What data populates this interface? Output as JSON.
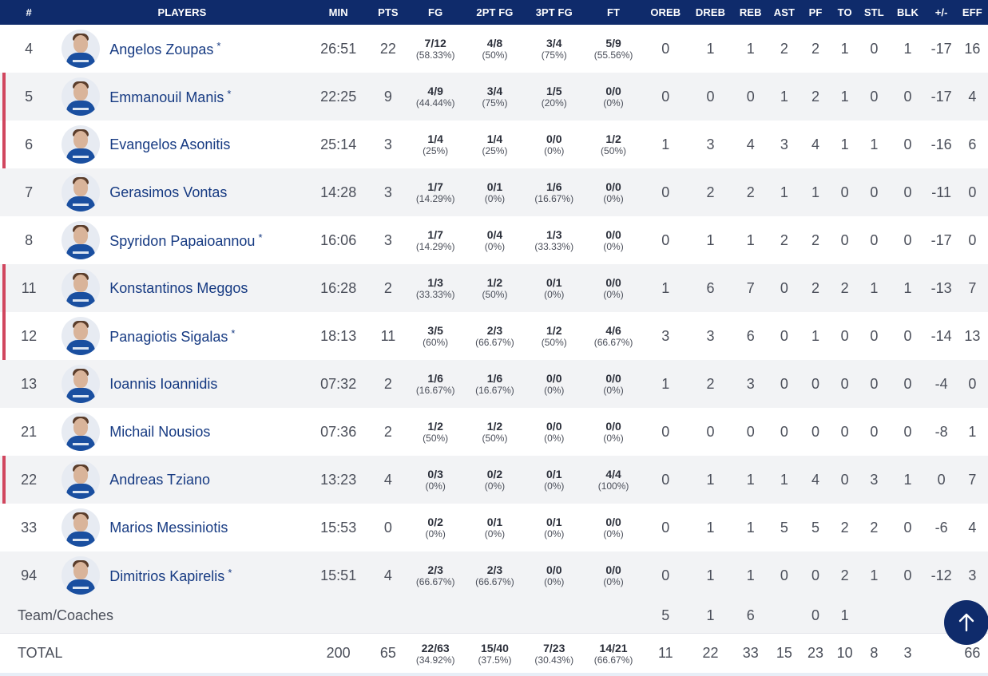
{
  "columns": [
    "#",
    "PLAYERS",
    "MIN",
    "PTS",
    "FG",
    "2PT FG",
    "3PT FG",
    "FT",
    "OREB",
    "DREB",
    "REB",
    "AST",
    "PF",
    "TO",
    "STL",
    "BLK",
    "+/-",
    "EFF"
  ],
  "players": [
    {
      "num": "4",
      "name": "Angelos Zoupas",
      "star": "*",
      "min": "26:51",
      "pts": "22",
      "fg": "7/12",
      "fg_pct": "(58.33%)",
      "two": "4/8",
      "two_pct": "(50%)",
      "three": "3/4",
      "three_pct": "(75%)",
      "ft": "5/9",
      "ft_pct": "(55.56%)",
      "oreb": "0",
      "dreb": "1",
      "reb": "1",
      "ast": "2",
      "pf": "2",
      "to": "1",
      "stl": "0",
      "blk": "1",
      "pm": "-17",
      "eff": "16"
    },
    {
      "num": "5",
      "name": "Emmanouil Manis",
      "star": "*",
      "min": "22:25",
      "pts": "9",
      "fg": "4/9",
      "fg_pct": "(44.44%)",
      "two": "3/4",
      "two_pct": "(75%)",
      "three": "1/5",
      "three_pct": "(20%)",
      "ft": "0/0",
      "ft_pct": "(0%)",
      "oreb": "0",
      "dreb": "0",
      "reb": "0",
      "ast": "1",
      "pf": "2",
      "to": "1",
      "stl": "0",
      "blk": "0",
      "pm": "-17",
      "eff": "4"
    },
    {
      "num": "6",
      "name": "Evangelos Asonitis",
      "star": "",
      "min": "25:14",
      "pts": "3",
      "fg": "1/4",
      "fg_pct": "(25%)",
      "two": "1/4",
      "two_pct": "(25%)",
      "three": "0/0",
      "three_pct": "(0%)",
      "ft": "1/2",
      "ft_pct": "(50%)",
      "oreb": "1",
      "dreb": "3",
      "reb": "4",
      "ast": "3",
      "pf": "4",
      "to": "1",
      "stl": "1",
      "blk": "0",
      "pm": "-16",
      "eff": "6"
    },
    {
      "num": "7",
      "name": "Gerasimos Vontas",
      "star": "",
      "min": "14:28",
      "pts": "3",
      "fg": "1/7",
      "fg_pct": "(14.29%)",
      "two": "0/1",
      "two_pct": "(0%)",
      "three": "1/6",
      "three_pct": "(16.67%)",
      "ft": "0/0",
      "ft_pct": "(0%)",
      "oreb": "0",
      "dreb": "2",
      "reb": "2",
      "ast": "1",
      "pf": "1",
      "to": "0",
      "stl": "0",
      "blk": "0",
      "pm": "-11",
      "eff": "0"
    },
    {
      "num": "8",
      "name": "Spyridon Papaioannou",
      "star": "*",
      "min": "16:06",
      "pts": "3",
      "fg": "1/7",
      "fg_pct": "(14.29%)",
      "two": "0/4",
      "two_pct": "(0%)",
      "three": "1/3",
      "three_pct": "(33.33%)",
      "ft": "0/0",
      "ft_pct": "(0%)",
      "oreb": "0",
      "dreb": "1",
      "reb": "1",
      "ast": "2",
      "pf": "2",
      "to": "0",
      "stl": "0",
      "blk": "0",
      "pm": "-17",
      "eff": "0"
    },
    {
      "num": "11",
      "name": "Konstantinos Meggos",
      "star": "",
      "min": "16:28",
      "pts": "2",
      "fg": "1/3",
      "fg_pct": "(33.33%)",
      "two": "1/2",
      "two_pct": "(50%)",
      "three": "0/1",
      "three_pct": "(0%)",
      "ft": "0/0",
      "ft_pct": "(0%)",
      "oreb": "1",
      "dreb": "6",
      "reb": "7",
      "ast": "0",
      "pf": "2",
      "to": "2",
      "stl": "1",
      "blk": "1",
      "pm": "-13",
      "eff": "7"
    },
    {
      "num": "12",
      "name": "Panagiotis Sigalas",
      "star": "*",
      "min": "18:13",
      "pts": "11",
      "fg": "3/5",
      "fg_pct": "(60%)",
      "two": "2/3",
      "two_pct": "(66.67%)",
      "three": "1/2",
      "three_pct": "(50%)",
      "ft": "4/6",
      "ft_pct": "(66.67%)",
      "oreb": "3",
      "dreb": "3",
      "reb": "6",
      "ast": "0",
      "pf": "1",
      "to": "0",
      "stl": "0",
      "blk": "0",
      "pm": "-14",
      "eff": "13"
    },
    {
      "num": "13",
      "name": "Ioannis Ioannidis",
      "star": "",
      "min": "07:32",
      "pts": "2",
      "fg": "1/6",
      "fg_pct": "(16.67%)",
      "two": "1/6",
      "two_pct": "(16.67%)",
      "three": "0/0",
      "three_pct": "(0%)",
      "ft": "0/0",
      "ft_pct": "(0%)",
      "oreb": "1",
      "dreb": "2",
      "reb": "3",
      "ast": "0",
      "pf": "0",
      "to": "0",
      "stl": "0",
      "blk": "0",
      "pm": "-4",
      "eff": "0"
    },
    {
      "num": "21",
      "name": "Michail Nousios",
      "star": "",
      "min": "07:36",
      "pts": "2",
      "fg": "1/2",
      "fg_pct": "(50%)",
      "two": "1/2",
      "two_pct": "(50%)",
      "three": "0/0",
      "three_pct": "(0%)",
      "ft": "0/0",
      "ft_pct": "(0%)",
      "oreb": "0",
      "dreb": "0",
      "reb": "0",
      "ast": "0",
      "pf": "0",
      "to": "0",
      "stl": "0",
      "blk": "0",
      "pm": "-8",
      "eff": "1"
    },
    {
      "num": "22",
      "name": "Andreas Tziano",
      "star": "",
      "min": "13:23",
      "pts": "4",
      "fg": "0/3",
      "fg_pct": "(0%)",
      "two": "0/2",
      "two_pct": "(0%)",
      "three": "0/1",
      "three_pct": "(0%)",
      "ft": "4/4",
      "ft_pct": "(100%)",
      "oreb": "0",
      "dreb": "1",
      "reb": "1",
      "ast": "1",
      "pf": "4",
      "to": "0",
      "stl": "3",
      "blk": "1",
      "pm": "0",
      "eff": "7"
    },
    {
      "num": "33",
      "name": "Marios Messiniotis",
      "star": "",
      "min": "15:53",
      "pts": "0",
      "fg": "0/2",
      "fg_pct": "(0%)",
      "two": "0/1",
      "two_pct": "(0%)",
      "three": "0/1",
      "three_pct": "(0%)",
      "ft": "0/0",
      "ft_pct": "(0%)",
      "oreb": "0",
      "dreb": "1",
      "reb": "1",
      "ast": "5",
      "pf": "5",
      "to": "2",
      "stl": "2",
      "blk": "0",
      "pm": "-6",
      "eff": "4"
    },
    {
      "num": "94",
      "name": "Dimitrios Kapirelis",
      "star": "*",
      "min": "15:51",
      "pts": "4",
      "fg": "2/3",
      "fg_pct": "(66.67%)",
      "two": "2/3",
      "two_pct": "(66.67%)",
      "three": "0/0",
      "three_pct": "(0%)",
      "ft": "0/0",
      "ft_pct": "(0%)",
      "oreb": "0",
      "dreb": "1",
      "reb": "1",
      "ast": "0",
      "pf": "0",
      "to": "2",
      "stl": "1",
      "blk": "0",
      "pm": "-12",
      "eff": "3"
    }
  ],
  "accent_rows": [
    1,
    2,
    5,
    6,
    9
  ],
  "team": {
    "label": "Team/Coaches",
    "oreb": "5",
    "dreb": "1",
    "reb": "6",
    "ast": "",
    "pf": "0",
    "to": "1",
    "stl": "",
    "blk": "",
    "pm": "",
    "eff": ""
  },
  "total": {
    "label": "TOTAL",
    "min": "200",
    "pts": "65",
    "fg": "22/63",
    "fg_pct": "(34.92%)",
    "two": "15/40",
    "two_pct": "(37.5%)",
    "three": "7/23",
    "three_pct": "(30.43%)",
    "ft": "14/21",
    "ft_pct": "(66.67%)",
    "oreb": "11",
    "dreb": "22",
    "reb": "33",
    "ast": "15",
    "pf": "23",
    "to": "10",
    "stl": "8",
    "blk": "3",
    "pm": "",
    "eff": "66"
  },
  "colors": {
    "header_bg": "#0f2b6b",
    "name_color": "#163a82",
    "accent": "#d1465e",
    "alt_row": "#f2f3f5"
  },
  "icons": {
    "avatar": "player-avatar-icon",
    "scroll_top": "arrow-up-icon"
  }
}
